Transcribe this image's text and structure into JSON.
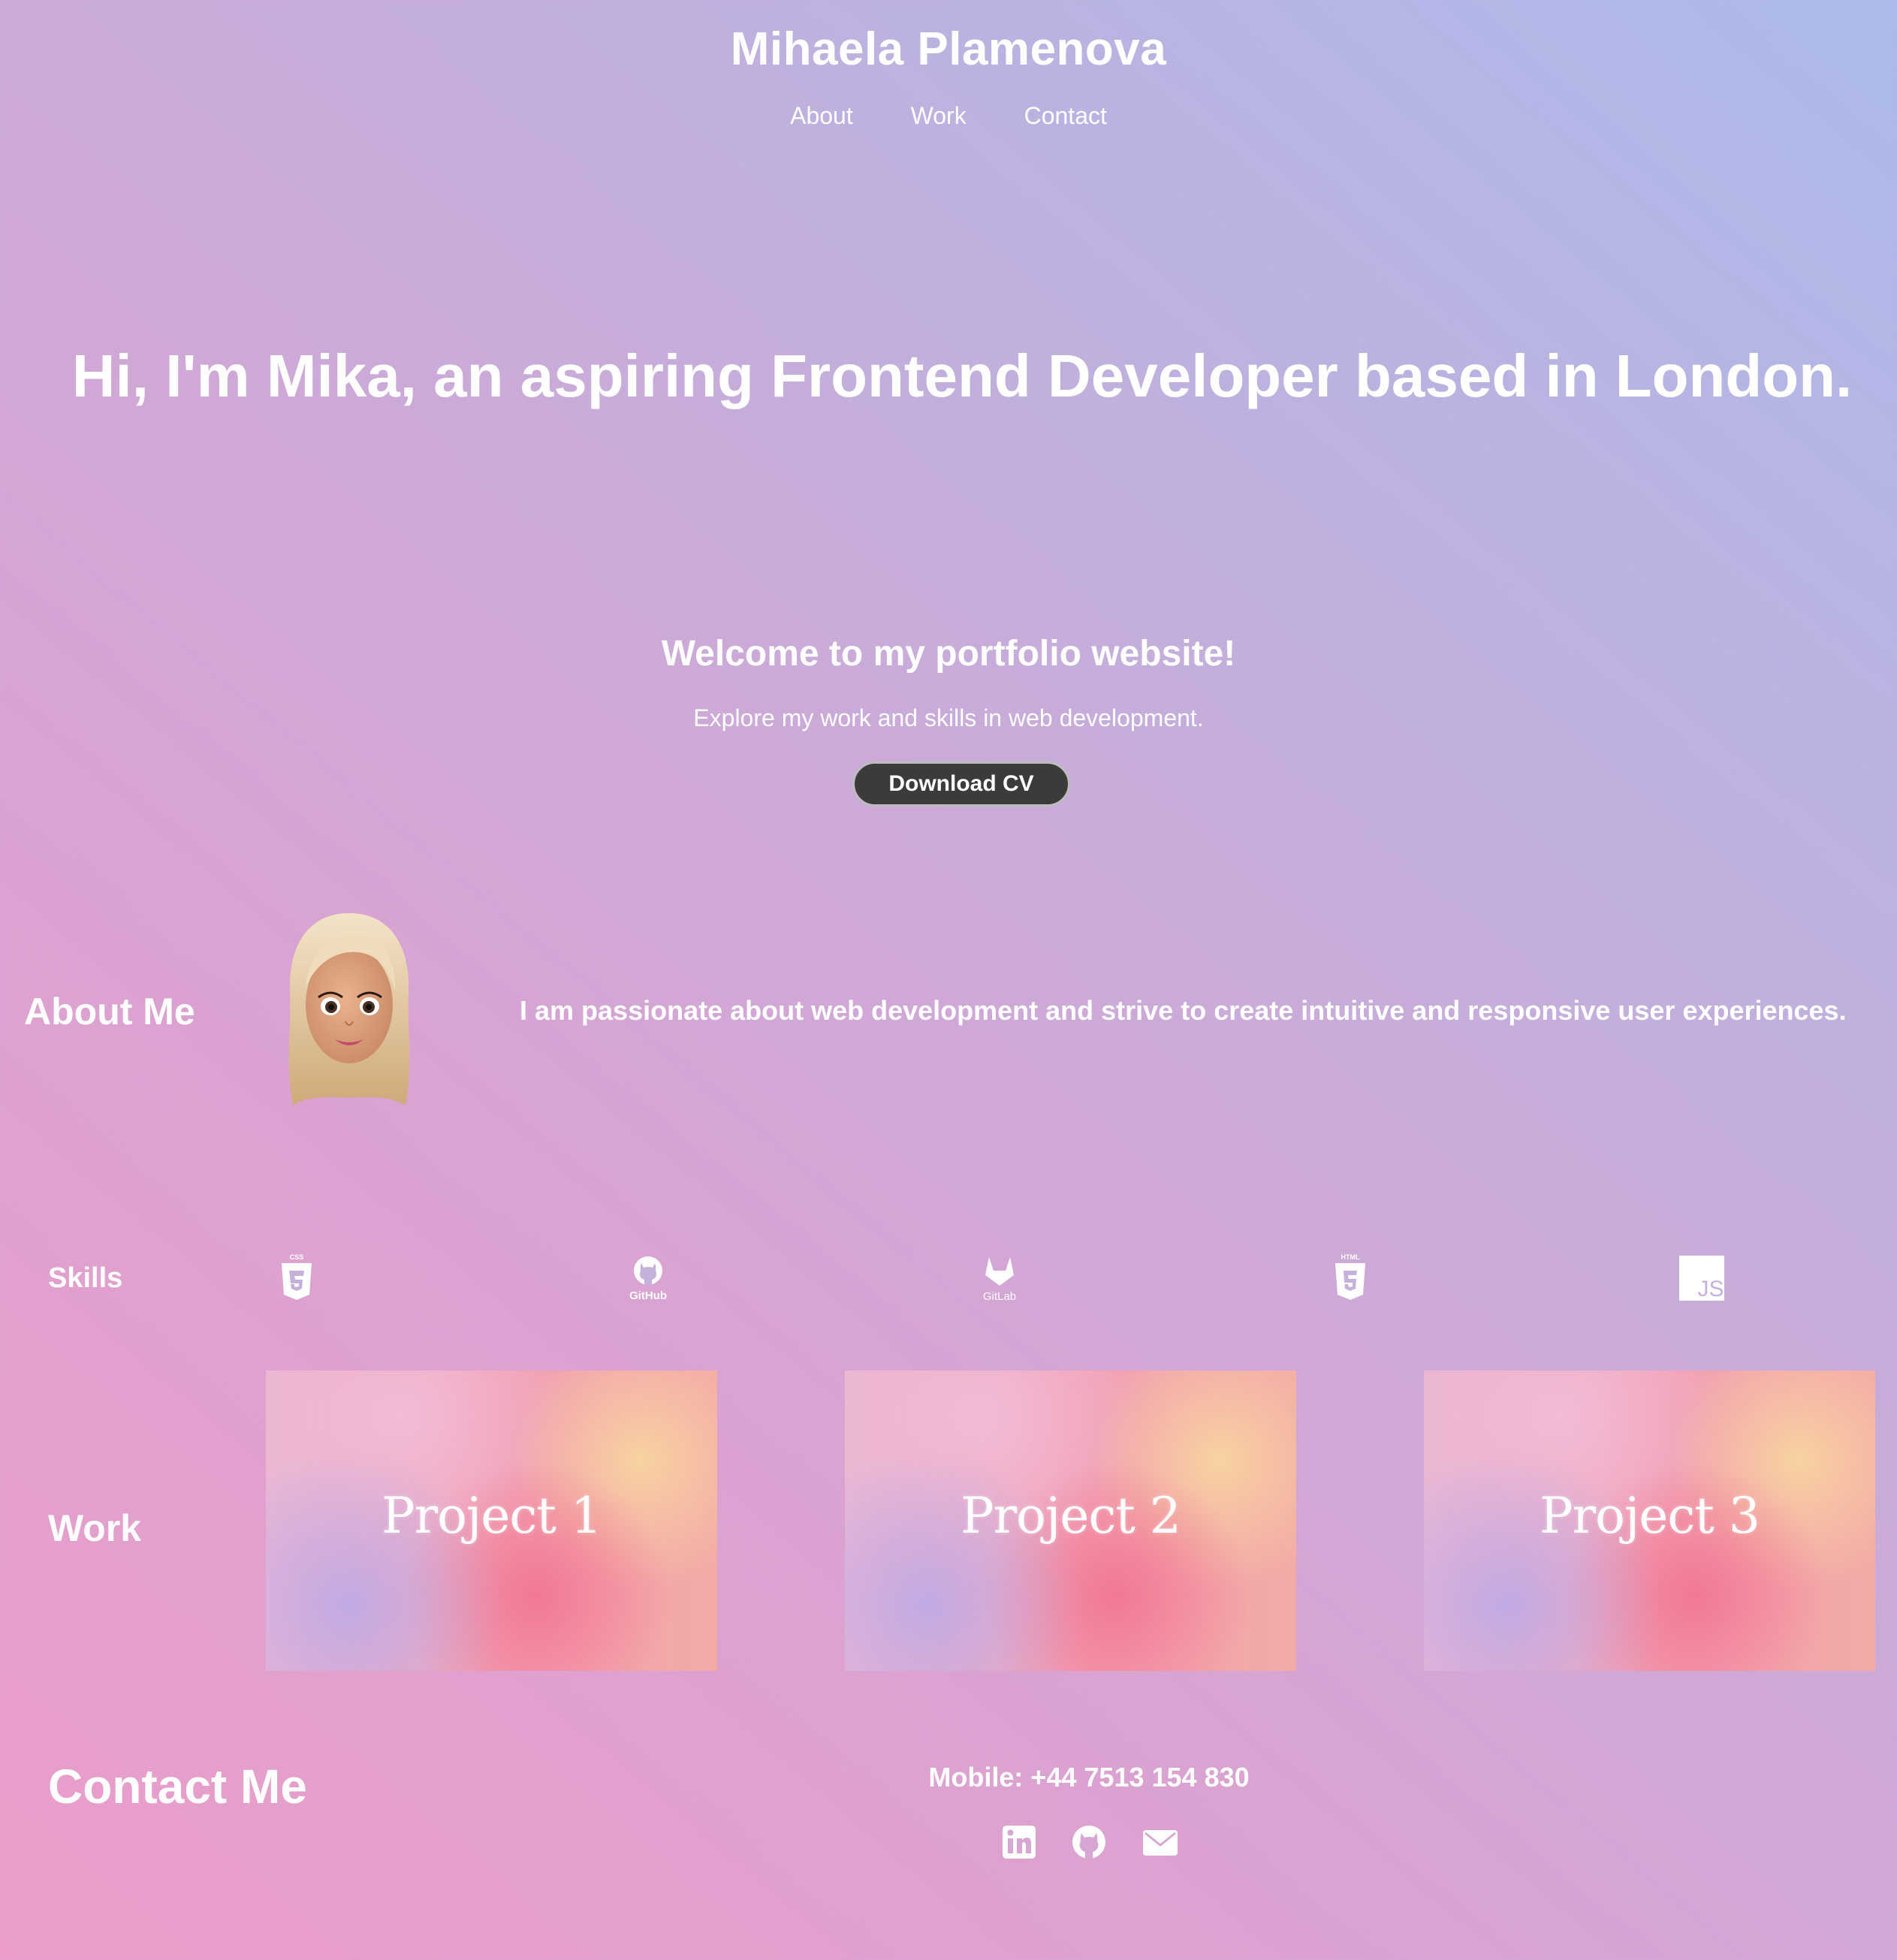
{
  "header": {
    "title": "Mihaela Plamenova",
    "nav": [
      "About",
      "Work",
      "Contact"
    ]
  },
  "hero": {
    "heading": "Hi, I'm Mika, an aspiring Frontend Developer based in London.",
    "welcome": "Welcome to my portfolio website!",
    "subtitle": "Explore my work and skills in web development.",
    "cta_label": "Download CV"
  },
  "about": {
    "title": "About Me",
    "avatar_icon": "memoji-avatar",
    "text": "I am passionate about web development and strive to create intuitive and responsive user experiences."
  },
  "skills": {
    "title": "Skills",
    "items": [
      {
        "icon": "css3-icon",
        "caption": "CSS"
      },
      {
        "icon": "github-icon",
        "caption": "GitHub"
      },
      {
        "icon": "gitlab-icon",
        "caption": "GitLab"
      },
      {
        "icon": "html5-icon",
        "caption": "HTML"
      },
      {
        "icon": "javascript-icon",
        "caption": "JS"
      }
    ]
  },
  "work": {
    "title": "Work",
    "projects": [
      "Project 1",
      "Project 2",
      "Project 3"
    ]
  },
  "contact": {
    "title": "Contact Me",
    "mobile": "Mobile: +44 7513 154 830",
    "icons": [
      "linkedin-icon",
      "github-icon",
      "email-icon"
    ]
  },
  "colors": {
    "text": "#ffffff",
    "button_bg": "#3d3b3a",
    "gradient_pink": "#eb9dc8",
    "gradient_blue": "#abbaea",
    "skill_icon_purple": "#c6b0dc"
  }
}
